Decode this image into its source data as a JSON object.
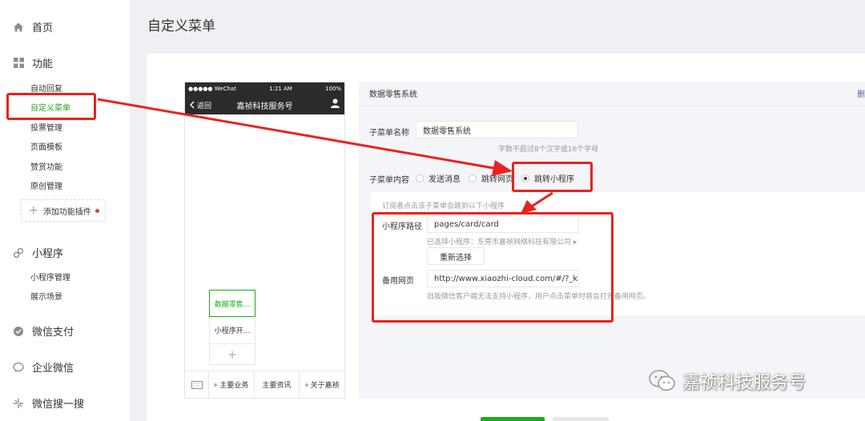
{
  "sidebar": {
    "home": "首页",
    "features": "功能",
    "features_items": [
      "自动回复",
      "自定义菜单",
      "投票管理",
      "页面模板",
      "赞赏功能",
      "原创管理"
    ],
    "add_plugin": "添加功能插件",
    "miniprogram": "小程序",
    "miniprogram_items": [
      "小程序管理",
      "展示场景"
    ],
    "wechat_pay": "微信支付",
    "work_wechat": "企业微信",
    "wechat_search": "微信搜一搜"
  },
  "page_title": "自定义菜单",
  "phone": {
    "carrier": "●●●●● WeChat",
    "time": "1:21 AM",
    "battery": "100%",
    "back": "返回",
    "account": "嘉祯科技服务号",
    "sub_buttons": [
      "数据零售...",
      "小程序开...",
      "+"
    ],
    "menu": [
      "主要业务",
      "主要资讯",
      "关于嘉祯"
    ]
  },
  "editor": {
    "header": "数据零售系统",
    "delete": "删",
    "name_label": "子菜单名称",
    "name_value": "数据零售系统",
    "name_hint": "字数不超过8个汉字或16个字母",
    "content_label": "子菜单内容",
    "options": [
      "发送消息",
      "跳转网页",
      "跳转小程序"
    ],
    "selected_option": "跳转小程序",
    "sub_hint": "订阅者点击该子菜单会跳到以下小程序",
    "path_label": "小程序路径",
    "path_value": "pages/card/card",
    "selected_hint": "已选择小程序：东莞市嘉祯网络科技有限公司 ▸",
    "reselect": "重新选择",
    "backup_label": "备用网页",
    "backup_value": "http://www.xiaozhi-cloud.com/#/?_k=c",
    "backup_hint": "旧版微信客户端无法支持小程序，用户点击菜单时将会打开备用网页。"
  },
  "watermark": "嘉祯科技服务号",
  "colors": {
    "accent": "#1aad19",
    "annotation": "#e8231e",
    "link": "#576b95"
  }
}
